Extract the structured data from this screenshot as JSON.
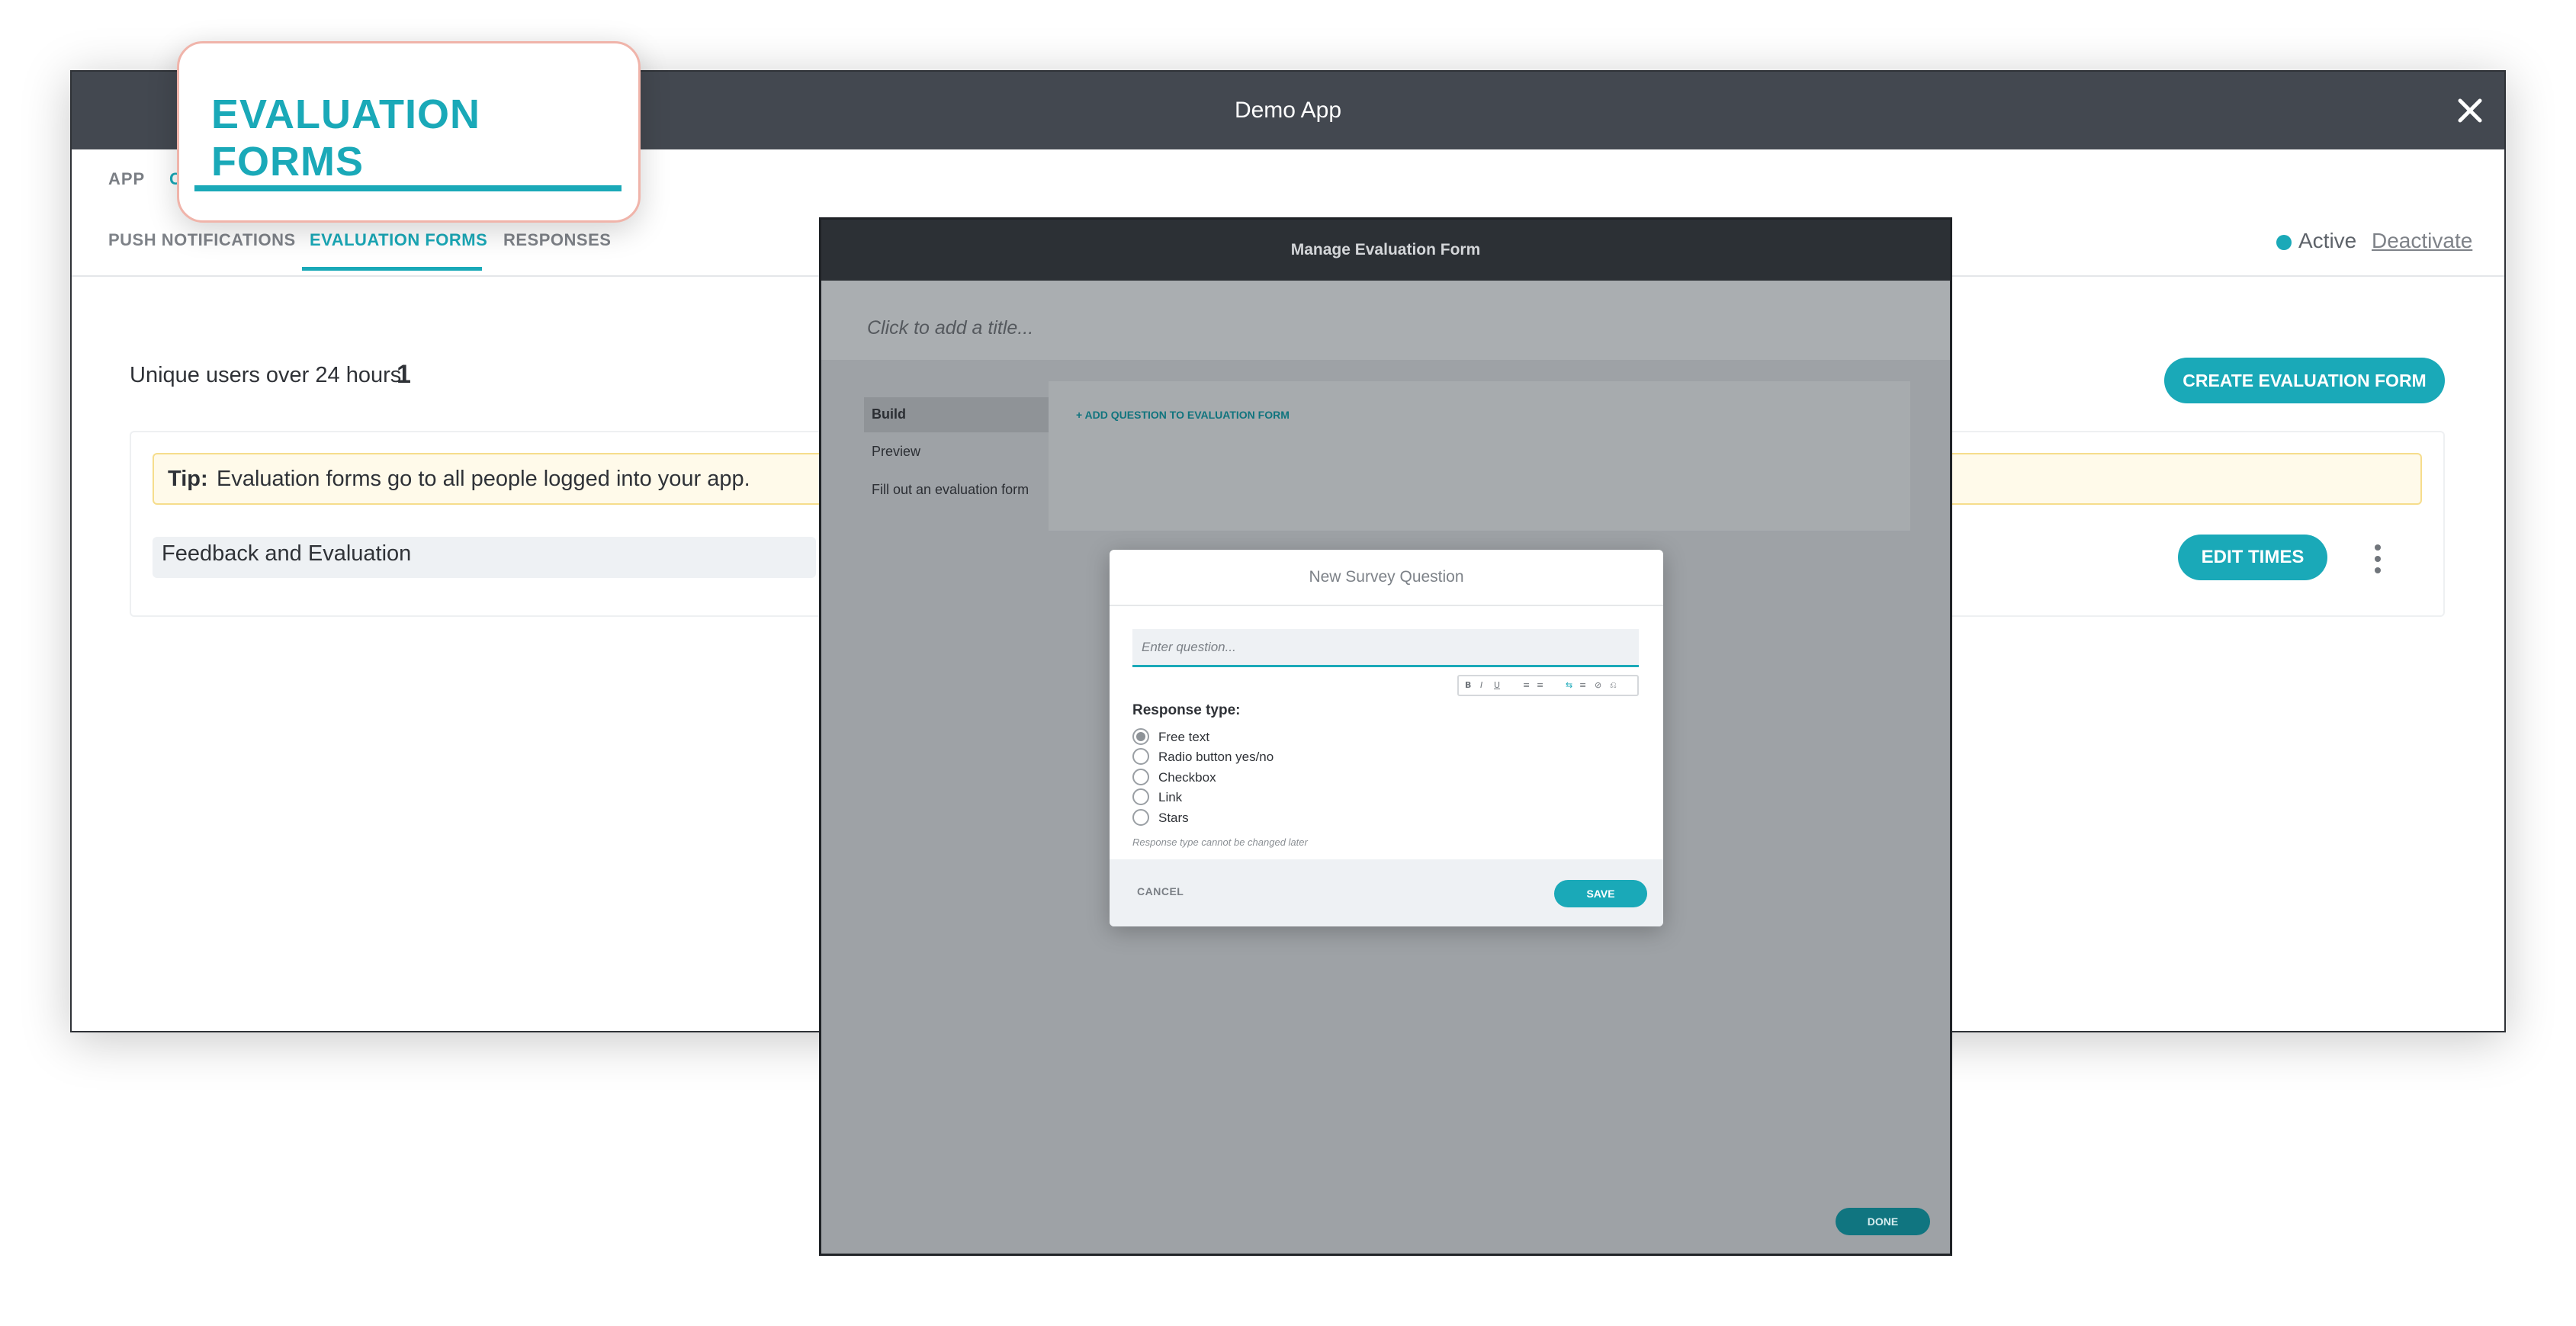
{
  "window": {
    "title": "Demo App"
  },
  "tabs_primary": [
    "APP",
    "C"
  ],
  "tabs_secondary": [
    {
      "label": "PUSH NOTIFICATIONS",
      "active": false
    },
    {
      "label": "EVALUATION FORMS",
      "active": true
    },
    {
      "label": "RESPONSES",
      "active": false
    }
  ],
  "status": {
    "label": "Active",
    "action": "Deactivate",
    "color": "#1aa9b8"
  },
  "stats": {
    "label": "Unique users over 24 hours:",
    "value": "1"
  },
  "create_button": "CREATE EVALUATION FORM",
  "tip": {
    "label": "Tip:",
    "text": "Evaluation forms go to all people logged into your app."
  },
  "form_row": {
    "name": "Feedback and Evaluation",
    "edit_button": "EDIT TIMES"
  },
  "callout": {
    "text": "EVALUATION FORMS"
  },
  "manage_panel": {
    "title": "Manage Evaluation Form",
    "title_placeholder": "Click to add a title...",
    "side_items": [
      "Build",
      "Preview",
      "Fill out an evaluation form"
    ],
    "add_question": "+ ADD QUESTION TO EVALUATION FORM",
    "done": "DONE"
  },
  "dialog": {
    "title": "New Survey Question",
    "question_placeholder": "Enter question...",
    "format_tools": [
      "B",
      "I",
      "U",
      "≡",
      "≡",
      "⇆",
      "≡",
      "⊘",
      "⎌"
    ],
    "response_label": "Response type:",
    "options": [
      "Free text",
      "Radio button yes/no",
      "Checkbox",
      "Link",
      "Stars"
    ],
    "selected_option": "Free text",
    "hint": "Response type cannot be changed later",
    "cancel": "CANCEL",
    "save": "SAVE"
  },
  "colors": {
    "accent": "#1aa9b8",
    "titlebar": "#434850",
    "tip_bg": "#fffaea"
  }
}
